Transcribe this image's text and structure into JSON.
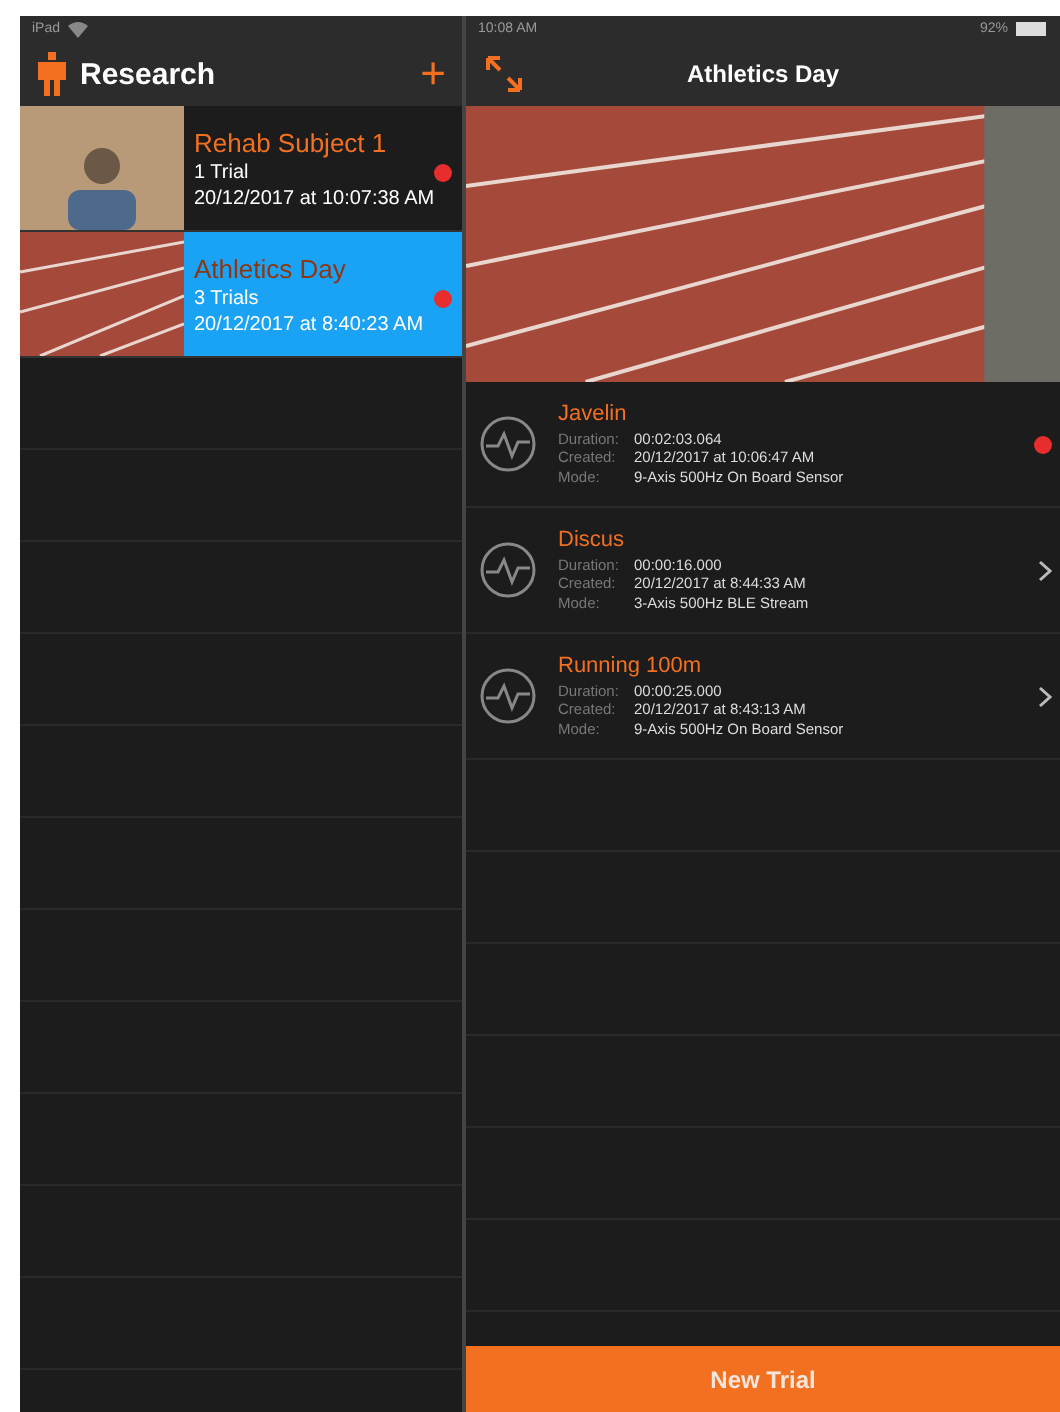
{
  "status_bar": {
    "device": "iPad",
    "time": "10:08 AM",
    "battery": "92%"
  },
  "sidebar": {
    "title": "Research",
    "add_label": "+",
    "items": [
      {
        "name": "Rehab Subject 1",
        "trials": "1 Trial",
        "date": "20/12/2017 at 10:07:38 AM",
        "selected": false,
        "kind": "person"
      },
      {
        "name": "Athletics Day",
        "trials": "3 Trials",
        "date": "20/12/2017 at 8:40:23 AM",
        "selected": true,
        "kind": "track"
      }
    ]
  },
  "detail": {
    "title": "Athletics Day",
    "trials": [
      {
        "name": "Javelin",
        "duration_label": "Duration:",
        "duration": "00:02:03.064",
        "created_label": "Created:",
        "created": "20/12/2017 at 10:06:47 AM",
        "mode_label": "Mode:",
        "mode": "9-Axis 500Hz On Board Sensor",
        "kind": "dot"
      },
      {
        "name": "Discus",
        "duration_label": "Duration:",
        "duration": "00:00:16.000",
        "created_label": "Created:",
        "created": "20/12/2017 at 8:44:33 AM",
        "mode_label": "Mode:",
        "mode": "3-Axis 500Hz BLE Stream",
        "kind": "chevron"
      },
      {
        "name": "Running 100m",
        "duration_label": "Duration:",
        "duration": "00:00:25.000",
        "created_label": "Created:",
        "created": "20/12/2017 at 8:43:13 AM",
        "mode_label": "Mode:",
        "mode": "9-Axis 500Hz On Board Sensor",
        "kind": "chevron"
      }
    ],
    "button": "New Trial"
  }
}
